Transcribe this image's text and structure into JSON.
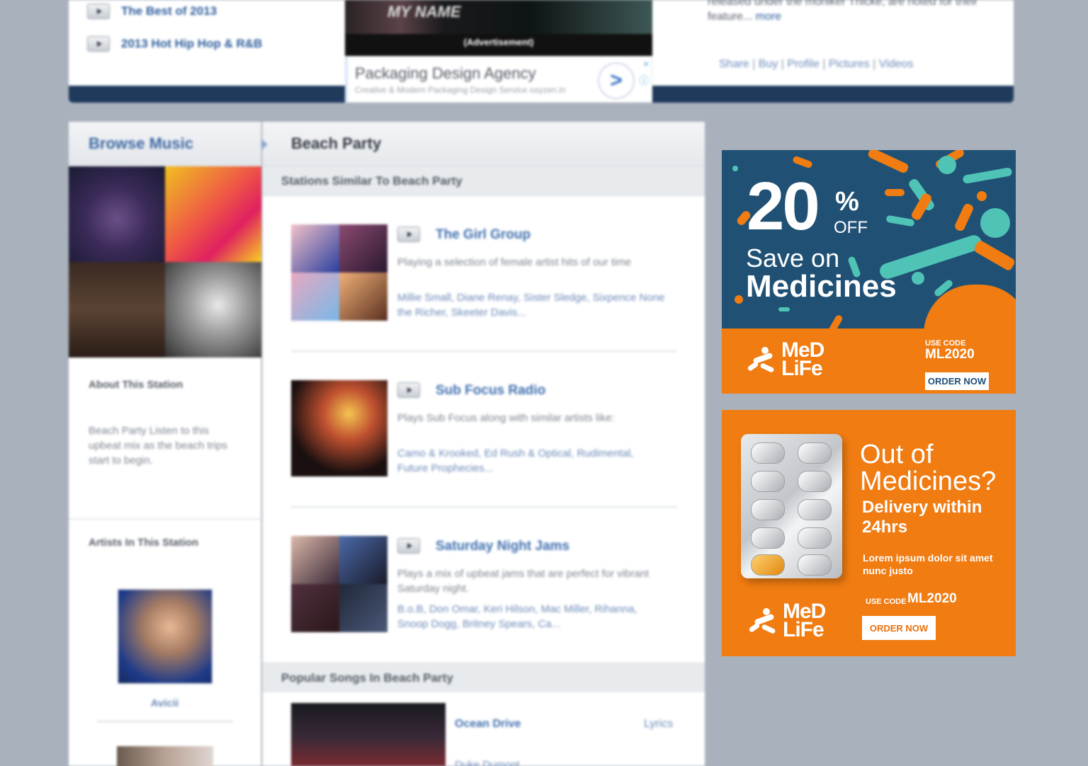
{
  "top": {
    "links": [
      {
        "label": "The Best of 2013"
      },
      {
        "label": "2013 Hot Hip Hop & R&B"
      }
    ],
    "video_label": "(Advertisement)",
    "video_overlay_text": "MY NAME",
    "google_ad": {
      "title": "Packaging Design Agency",
      "subtitle": "Creative & Modern Packaging Design Service",
      "domain": "oxyzen.in",
      "arrow": ">",
      "close": "×",
      "info": "ⓘ"
    },
    "bio": {
      "text": "released under the moniker Thicke, are noted for their feature...",
      "more": "more"
    },
    "artist_links": [
      "Share",
      "Buy",
      "Profile",
      "Pictures",
      "Videos"
    ],
    "separator": "|"
  },
  "left": {
    "browse_title": "Browse Music",
    "about_title": "About This Station",
    "about_text": "Beach Party Listen to this upbeat mix as the beach trips start to begin.",
    "artists_title": "Artists In This Station",
    "artists": [
      {
        "name": "Avicii"
      }
    ]
  },
  "center": {
    "page_title": "Beach Party",
    "similar_title": "Stations Similar To Beach Party",
    "stations": [
      {
        "title": "The Girl Group",
        "description": "Playing a selection of female artist hits of our time",
        "artists": "Millie Small, Diane Renay, Sister Sledge, Sixpence None the Richer, Skeeter Davis..."
      },
      {
        "title": "Sub Focus Radio",
        "description": "Plays Sub Focus along with similar artists like:",
        "artists": "Camo & Krooked, Ed Rush & Optical, Rudimental, Future Prophecies..."
      },
      {
        "title": "Saturday Night Jams",
        "description": "Plays a mix of upbeat jams that are perfect for vibrant Saturday night.",
        "artists": "B.o.B, Don Omar, Keri Hilson, Mac Miller, Rihanna, Snoop Dogg, Britney Spears, Ca..."
      }
    ],
    "popular_title": "Popular Songs In Beach Party",
    "songs": [
      {
        "title": "Ocean Drive",
        "lyrics": "Lyrics",
        "artist": "Duke Dumont"
      }
    ]
  },
  "ads": {
    "ad1": {
      "percent": "20",
      "percent_sign": "%",
      "off": "OFF",
      "line1": "Save on",
      "line2": "Medicines",
      "brand_line1": "MeD",
      "brand_line2": "LiFe",
      "use_code_label": "USE CODE",
      "code": "ML2020",
      "cta": "ORDER NOW",
      "colors": {
        "navy": "#205175",
        "orange": "#f07c12",
        "teal": "#4fc3b5"
      }
    },
    "ad2": {
      "headline": "Out of Medicines?",
      "subhead": "Delivery within 24hrs",
      "body": "Lorem ipsum dolor sit amet nunc justo",
      "use_code_label": "USE CODE",
      "code": "ML2020",
      "cta": "ORDER NOW",
      "brand_line1": "MeD",
      "brand_line2": "LiFe"
    }
  }
}
